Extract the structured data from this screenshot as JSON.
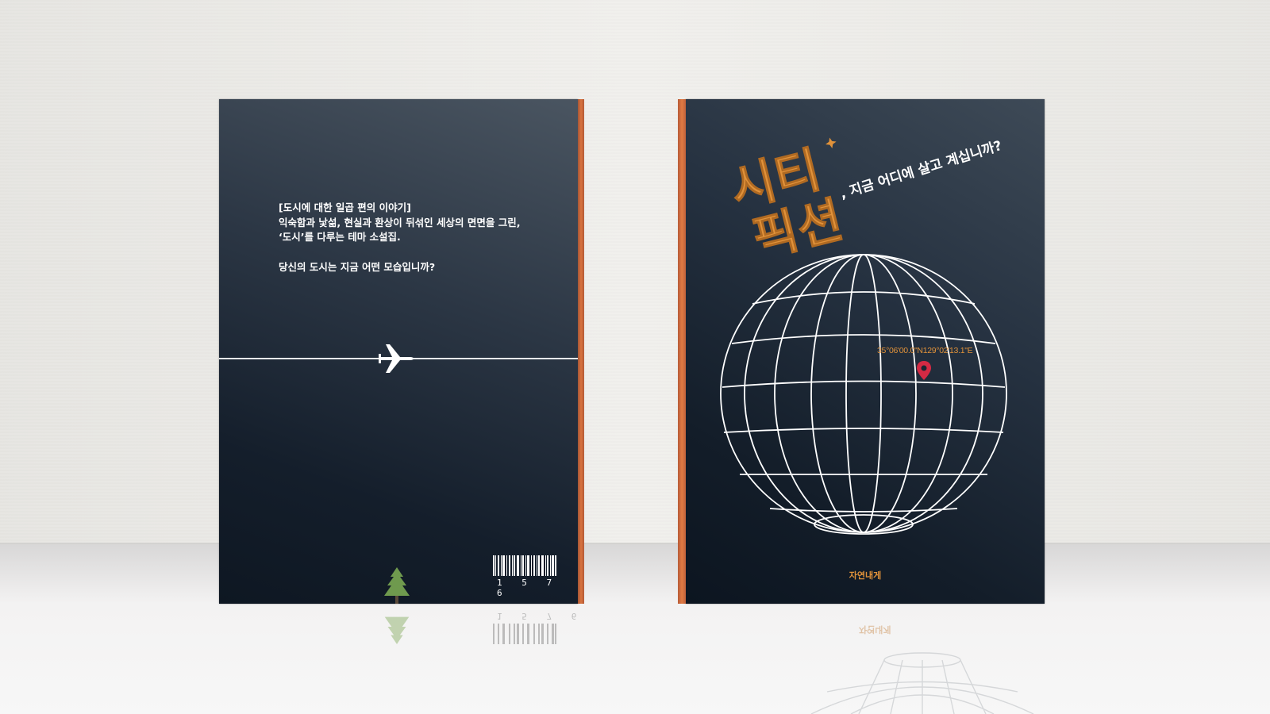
{
  "back_cover": {
    "blurb_lines": [
      "[도시에 대한 일곱 편의 이야기]",
      "익숙함과 낯섦, 현실과 환상이 뒤섞인 세상의 면면을 그린,",
      "‘도시’를 다루는 테마 소설집."
    ],
    "question": "당신의 도시는 지금 어떤 모습입니까?",
    "barcode_number": "1 5 7 6"
  },
  "front_cover": {
    "title_line1": "시티",
    "title_line2": "픽션",
    "subtitle": ", 지금 어디에 살고 계십니까?",
    "coordinates": "35°06'00.0\"N129°02'13.1\"E",
    "publisher": "자연내게"
  },
  "colors": {
    "cover": "#1b2633",
    "accent_orange": "#e1923a",
    "spine": "#d9733f",
    "pin": "#d42a44",
    "tree": "#6f9a4e"
  },
  "icons": [
    "airplane-icon",
    "tree-icon",
    "map-pin-icon",
    "barcode"
  ]
}
